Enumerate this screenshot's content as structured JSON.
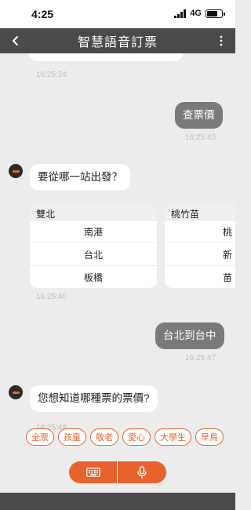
{
  "status": {
    "time": "4:25",
    "network": "4G"
  },
  "header": {
    "title": "智慧語音訂票"
  },
  "chat": {
    "timestamps": [
      "16:25:24",
      "16:25:40",
      "16:25:40",
      "16:25:47",
      "16:25:48"
    ],
    "messages": {
      "user_check_price": "查票價",
      "bot_from_station": "要從哪一站出發？",
      "user_route": "台北到台中",
      "bot_ticket_type": "您想知道哪種票的票價?"
    },
    "station_cards": [
      {
        "region": "雙北",
        "stations": [
          "南港",
          "台北",
          "板橋"
        ]
      },
      {
        "region": "桃竹苗",
        "stations": [
          "桃",
          "新",
          "苗"
        ]
      }
    ]
  },
  "quick_replies": [
    "全票",
    "孩童",
    "敬老",
    "愛心",
    "大學生",
    "早鳥"
  ],
  "colors": {
    "accent": "#e8622c",
    "header": "#4a4a4a",
    "background": "#ececec"
  },
  "icons": {
    "keyboard": "keyboard-icon",
    "mic": "microphone-icon"
  }
}
